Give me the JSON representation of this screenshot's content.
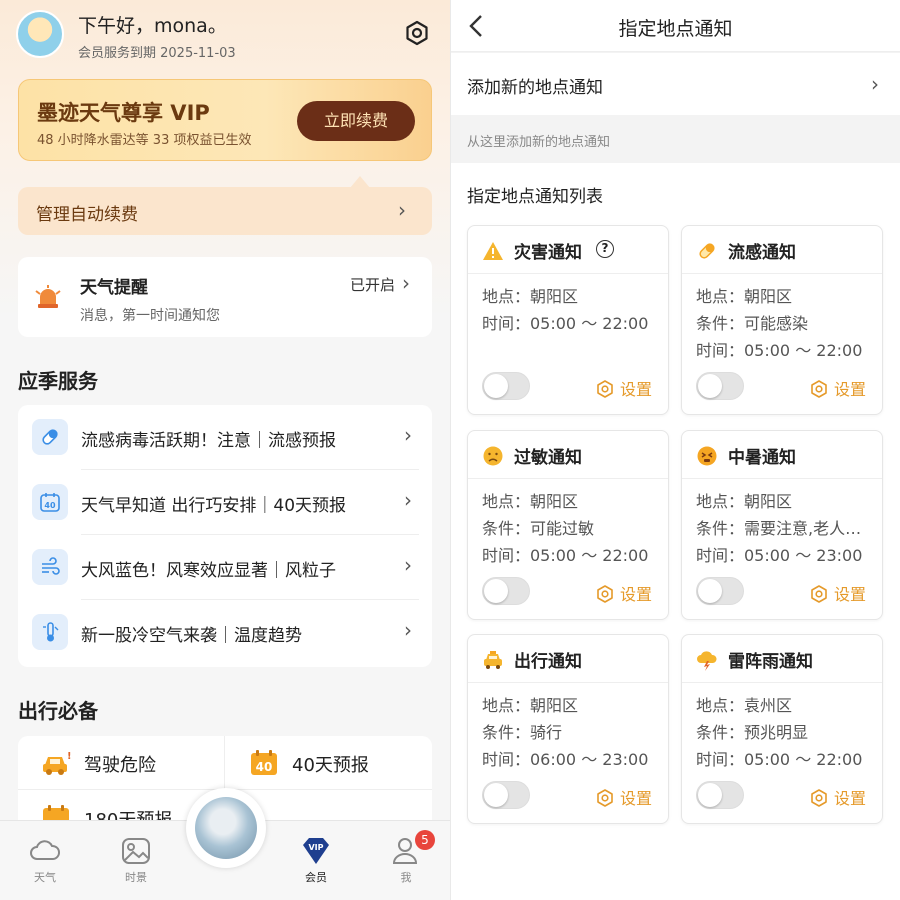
{
  "profile": {
    "greeting": "下午好，mona。",
    "expiry": "会员服务到期 2025-11-03"
  },
  "vip": {
    "title": "墨迹天气尊享 VIP",
    "subtitle": "48 小时降水雷达等 33 项权益已生效",
    "renew_label": "立即续费",
    "manage_label": "管理自动续费"
  },
  "reminder": {
    "title": "天气提醒",
    "desc": "消息，第一时间通知您",
    "status": "已开启"
  },
  "seasonal": {
    "heading": "应季服务",
    "items": [
      {
        "label": "流感病毒活跃期！注意｜流感预报",
        "icon": "pill-icon"
      },
      {
        "label": "天气早知道 出行巧安排｜40天预报",
        "icon": "calendar-40-icon"
      },
      {
        "label": "大风蓝色！风寒效应显著｜风粒子",
        "icon": "wind-icon"
      },
      {
        "label": "新一股冷空气来袭｜温度趋势",
        "icon": "thermometer-icon"
      }
    ]
  },
  "travel": {
    "heading": "出行必备",
    "items": [
      {
        "label": "驾驶危险",
        "icon": "car-warning-icon"
      },
      {
        "label": "40天预报",
        "icon": "calendar-40-icon",
        "icon_text": "40"
      },
      {
        "label": "180天预报",
        "icon": "calendar-180-icon"
      }
    ]
  },
  "tabbar": {
    "tabs": [
      {
        "label": "天气",
        "icon": "cloud-icon"
      },
      {
        "label": "时景",
        "icon": "picture-icon"
      },
      {
        "label": "会员",
        "icon": "vip-diamond-icon",
        "icon_text": "VIP"
      },
      {
        "label": "我",
        "icon": "user-icon"
      }
    ],
    "badge": "5"
  },
  "location_notify": {
    "nav_title": "指定地点通知",
    "add_label": "添加新的地点通知",
    "hint": "从这里添加新的地点通知",
    "list_title": "指定地点通知列表",
    "set_label": "设置",
    "cards": [
      {
        "title": "灾害通知",
        "icon": "warning-icon",
        "help": "?",
        "lines": [
          "地点：朝阳区",
          "时间：05:00 ～ 22:00"
        ],
        "enabled": false
      },
      {
        "title": "流感通知",
        "icon": "pill-icon",
        "lines": [
          "地点：朝阳区",
          "条件：可能感染",
          "时间：05:00 ～ 22:00"
        ],
        "enabled": false
      },
      {
        "title": "过敏通知",
        "icon": "sad-face-icon",
        "lines": [
          "地点：朝阳区",
          "条件：可能过敏",
          "时间：05:00 ～ 22:00"
        ],
        "enabled": false
      },
      {
        "title": "中暑通知",
        "icon": "hot-face-icon",
        "lines": [
          "地点：朝阳区",
          "条件：需要注意,老人…",
          "时间：05:00 ～ 23:00"
        ],
        "enabled": false
      },
      {
        "title": "出行通知",
        "icon": "taxi-icon",
        "lines": [
          "地点：朝阳区",
          "条件：骑行",
          "时间：06:00 ～ 23:00"
        ],
        "enabled": false
      },
      {
        "title": "雷阵雨通知",
        "icon": "thunderstorm-icon",
        "lines": [
          "地点：袁州区",
          "条件：预兆明显",
          "时间：05:00 ～ 22:00"
        ],
        "enabled": false
      }
    ]
  },
  "colors": {
    "accent": "#e59a2a",
    "renew_bg": "#6b2e17",
    "vip_text": "#6b3a10",
    "badge": "#e8453c"
  }
}
